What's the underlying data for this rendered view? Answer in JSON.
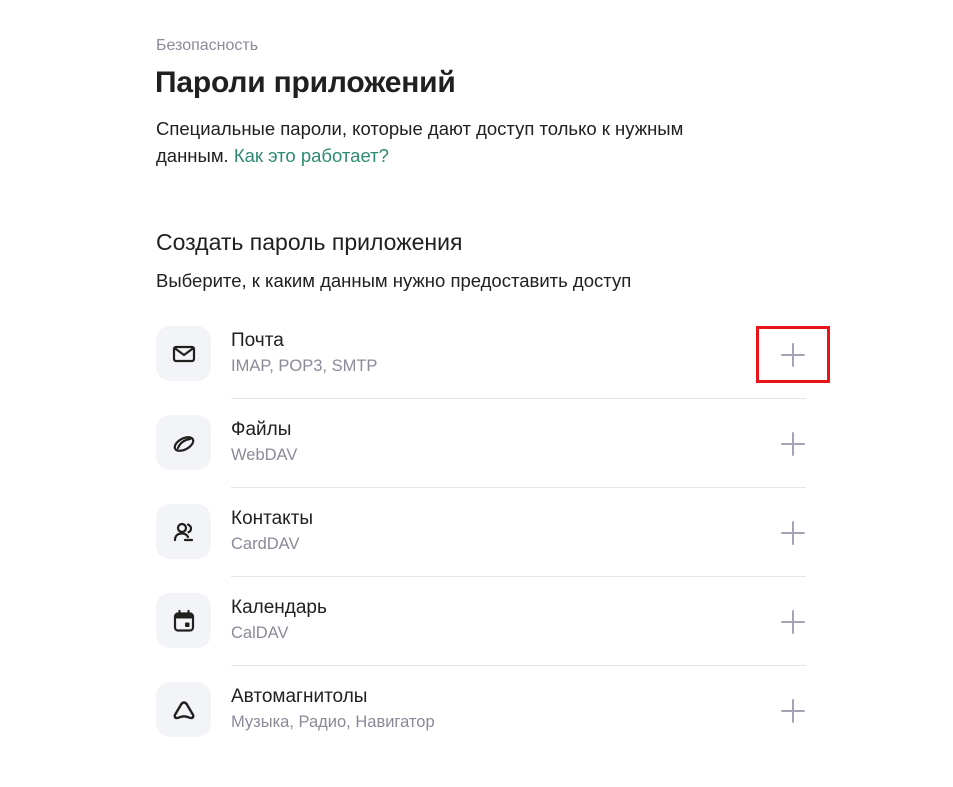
{
  "breadcrumb": "Безопасность",
  "title": "Пароли приложений",
  "description": "Специальные пароли, которые дают доступ только к нужным данным.",
  "how_link": "Как это работает?",
  "section": {
    "title": "Создать пароль приложения",
    "subtitle": "Выберите, к каким данным нужно предоставить доступ"
  },
  "items": [
    {
      "title": "Почта",
      "subtitle": "IMAP, POP3, SMTP",
      "icon": "mail-icon"
    },
    {
      "title": "Файлы",
      "subtitle": "WebDAV",
      "icon": "disk-icon"
    },
    {
      "title": "Контакты",
      "subtitle": "CardDAV",
      "icon": "contacts-icon"
    },
    {
      "title": "Календарь",
      "subtitle": "CalDAV",
      "icon": "calendar-icon"
    },
    {
      "title": "Автомагнитолы",
      "subtitle": "Музыка, Радио, Навигатор",
      "icon": "car-audio-icon"
    }
  ],
  "colors": {
    "link": "#2e8a72",
    "muted": "#8a8a99",
    "highlight": "#e8141a",
    "icon_bg": "#f3f4f7"
  }
}
